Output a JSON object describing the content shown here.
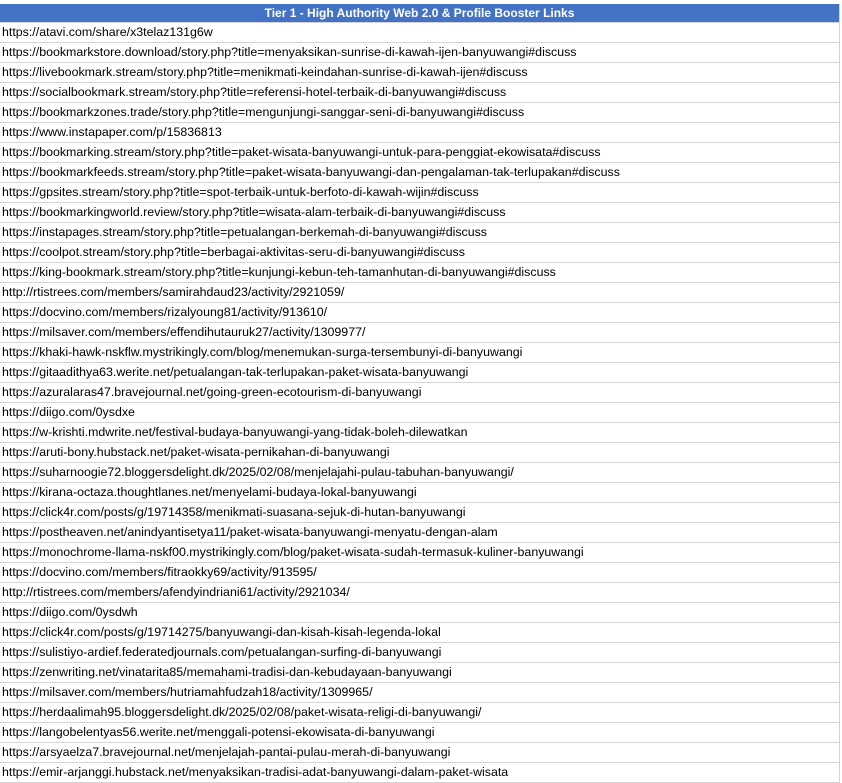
{
  "header": {
    "title": "Tier 1 - High Authority Web 2.0 & Profile Booster Links"
  },
  "colors": {
    "header_bg": "#4472c4",
    "header_text": "#ffffff",
    "gridline": "#d4d4d4"
  },
  "rows": [
    "https://atavi.com/share/x3telaz131g6w",
    "https://bookmarkstore.download/story.php?title=menyaksikan-sunrise-di-kawah-ijen-banyuwangi#discuss",
    "https://livebookmark.stream/story.php?title=menikmati-keindahan-sunrise-di-kawah-ijen#discuss",
    "https://socialbookmark.stream/story.php?title=referensi-hotel-terbaik-di-banyuwangi#discuss",
    "https://bookmarkzones.trade/story.php?title=mengunjungi-sanggar-seni-di-banyuwangi#discuss",
    "https://www.instapaper.com/p/15836813",
    "https://bookmarking.stream/story.php?title=paket-wisata-banyuwangi-untuk-para-penggiat-ekowisata#discuss",
    "https://bookmarkfeeds.stream/story.php?title=paket-wisata-banyuwangi-dan-pengalaman-tak-terlupakan#discuss",
    "https://gpsites.stream/story.php?title=spot-terbaik-untuk-berfoto-di-kawah-wijin#discuss",
    "https://bookmarkingworld.review/story.php?title=wisata-alam-terbaik-di-banyuwangi#discuss",
    "https://instapages.stream/story.php?title=petualangan-berkemah-di-banyuwangi#discuss",
    "https://coolpot.stream/story.php?title=berbagai-aktivitas-seru-di-banyuwangi#discuss",
    "https://king-bookmark.stream/story.php?title=kunjungi-kebun-teh-tamanhutan-di-banyuwangi#discuss",
    "http://rtistrees.com/members/samirahdaud23/activity/2921059/",
    "https://docvino.com/members/rizalyoung81/activity/913610/",
    "https://milsaver.com/members/effendihutauruk27/activity/1309977/",
    "https://khaki-hawk-nskflw.mystrikingly.com/blog/menemukan-surga-tersembunyi-di-banyuwangi",
    "https://gitaadithya63.werite.net/petualangan-tak-terlupakan-paket-wisata-banyuwangi",
    "https://azuralaras47.bravejournal.net/going-green-ecotourism-di-banyuwangi",
    "https://diigo.com/0ysdxe",
    "https://w-krishti.mdwrite.net/festival-budaya-banyuwangi-yang-tidak-boleh-dilewatkan",
    "https://aruti-bony.hubstack.net/paket-wisata-pernikahan-di-banyuwangi",
    "https://suharnoogie72.bloggersdelight.dk/2025/02/08/menjelajahi-pulau-tabuhan-banyuwangi/",
    "https://kirana-octaza.thoughtlanes.net/menyelami-budaya-lokal-banyuwangi",
    "https://click4r.com/posts/g/19714358/menikmati-suasana-sejuk-di-hutan-banyuwangi",
    "https://postheaven.net/anindyantisetya11/paket-wisata-banyuwangi-menyatu-dengan-alam",
    "https://monochrome-llama-nskf00.mystrikingly.com/blog/paket-wisata-sudah-termasuk-kuliner-banyuwangi",
    "https://docvino.com/members/fitraokky69/activity/913595/",
    "http://rtistrees.com/members/afendyindriani61/activity/2921034/",
    "https://diigo.com/0ysdwh",
    "https://click4r.com/posts/g/19714275/banyuwangi-dan-kisah-kisah-legenda-lokal",
    "https://sulistiyo-ardief.federatedjournals.com/petualangan-surfing-di-banyuwangi",
    "https://zenwriting.net/vinatarita85/memahami-tradisi-dan-kebudayaan-banyuwangi",
    "https://milsaver.com/members/hutriamahfudzah18/activity/1309965/",
    "https://herdaalimah95.bloggersdelight.dk/2025/02/08/paket-wisata-religi-di-banyuwangi/",
    "https://langobelentyas56.werite.net/menggali-potensi-ekowisata-di-banyuwangi",
    "https://arsyaelza7.bravejournal.net/menjelajah-pantai-pulau-merah-di-banyuwangi",
    "https://emir-arjanggi.hubstack.net/menyaksikan-tradisi-adat-banyuwangi-dalam-paket-wisata"
  ]
}
